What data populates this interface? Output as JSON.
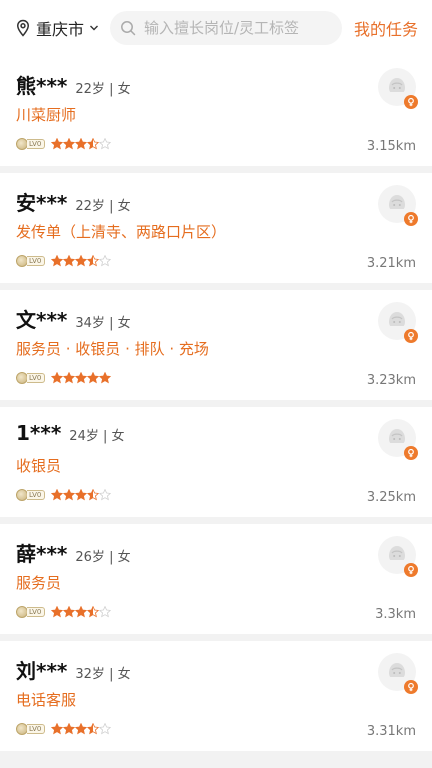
{
  "header": {
    "city": "重庆市",
    "search_placeholder": "输入擅长岗位/灵工标签",
    "my_tasks": "我的任务"
  },
  "icons": {
    "location": "location-pin-icon",
    "dropdown": "chevron-down-icon",
    "search": "search-icon",
    "avatar": "default-avatar-icon",
    "gender": "female-icon",
    "level": "level-badge-icon",
    "star": "star-icon"
  },
  "colors": {
    "accent": "#e8702a",
    "star": "#e8702a",
    "star_empty": "#cfcfcf"
  },
  "workers": [
    {
      "name": "熊***",
      "age": "22岁",
      "gender": "女",
      "job": "川菜厨师",
      "level": "LV0",
      "rating": 3.5,
      "distance": "3.15km"
    },
    {
      "name": "安***",
      "age": "22岁",
      "gender": "女",
      "job": "发传单（上清寺、两路口片区）",
      "level": "LV0",
      "rating": 3.5,
      "distance": "3.21km"
    },
    {
      "name": "文***",
      "age": "34岁",
      "gender": "女",
      "job": "服务员 · 收银员 · 排队 · 充场",
      "level": "LV0",
      "rating": 5,
      "distance": "3.23km"
    },
    {
      "name": "1***",
      "age": "24岁",
      "gender": "女",
      "job": "收银员",
      "level": "LV0",
      "rating": 3.5,
      "distance": "3.25km"
    },
    {
      "name": "薛***",
      "age": "26岁",
      "gender": "女",
      "job": "服务员",
      "level": "LV0",
      "rating": 3.5,
      "distance": "3.3km"
    },
    {
      "name": "刘***",
      "age": "32岁",
      "gender": "女",
      "job": "电话客服",
      "level": "LV0",
      "rating": 3.5,
      "distance": "3.31km"
    }
  ]
}
